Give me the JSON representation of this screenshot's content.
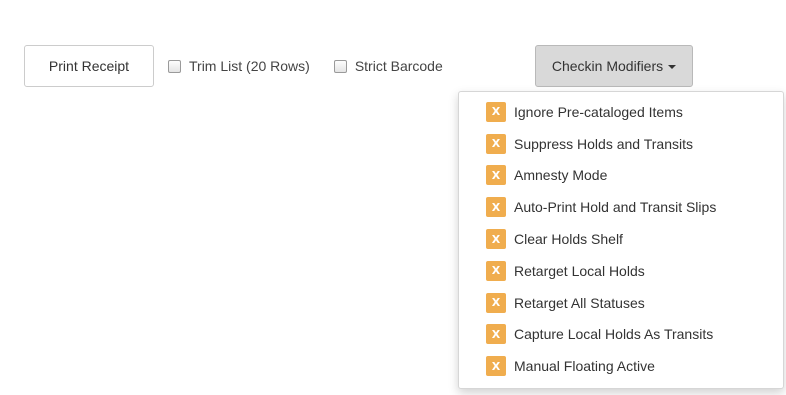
{
  "toolbar": {
    "print_receipt_label": "Print Receipt",
    "trim_list_label": "Trim List (20 Rows)",
    "trim_list_checked": false,
    "strict_barcode_label": "Strict Barcode",
    "strict_barcode_checked": false
  },
  "modifiers": {
    "button_label": "Checkin Modifiers",
    "badge_glyph": "X",
    "badge_color": "#f0ad4e",
    "items": [
      {
        "label": "Ignore Pre-cataloged Items"
      },
      {
        "label": "Suppress Holds and Transits"
      },
      {
        "label": "Amnesty Mode"
      },
      {
        "label": "Auto-Print Hold and Transit Slips"
      },
      {
        "label": "Clear Holds Shelf"
      },
      {
        "label": "Retarget Local Holds"
      },
      {
        "label": "Retarget All Statuses"
      },
      {
        "label": "Capture Local Holds As Transits"
      },
      {
        "label": "Manual Floating Active"
      }
    ]
  }
}
